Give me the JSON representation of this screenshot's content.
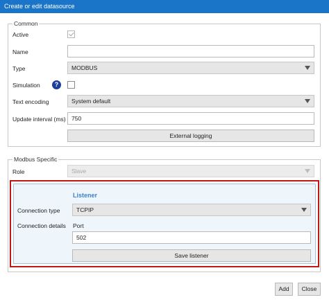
{
  "window": {
    "title": "Create or edit datasource"
  },
  "common": {
    "legend": "Common",
    "active_label": "Active",
    "name_label": "Name",
    "name_value": "",
    "type_label": "Type",
    "type_value": "MODBUS",
    "simulation_label": "Simulation",
    "help_glyph": "?",
    "text_encoding_label": "Text encoding",
    "text_encoding_value": "System default",
    "update_interval_label": "Update interval (ms)",
    "update_interval_value": "750",
    "external_logging_label": "External logging"
  },
  "modbus": {
    "legend": "Modbus Specific",
    "role_label": "Role",
    "role_value": "Slave"
  },
  "listener": {
    "title": "Listener",
    "connection_type_label": "Connection type",
    "connection_type_value": "TCPIP",
    "connection_details_label": "Connection details",
    "port_label": "Port",
    "port_value": "502",
    "save_label": "Save listener"
  },
  "footer": {
    "add_label": "Add",
    "close_label": "Close"
  },
  "colors": {
    "titlebar": "#1a74c7",
    "accent": "#3d83c9",
    "highlight_border": "#c01616",
    "help_icon": "#1c3d9c"
  }
}
